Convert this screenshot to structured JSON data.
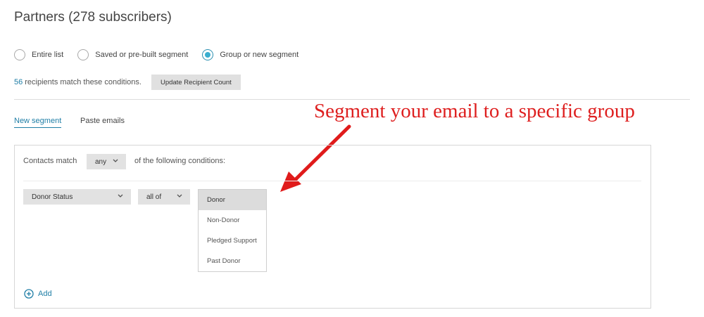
{
  "page_title": "Partners (278 subscribers)",
  "recipient_options": [
    {
      "label": "Entire list",
      "selected": false
    },
    {
      "label": "Saved or pre-built segment",
      "selected": false
    },
    {
      "label": "Group or new segment",
      "selected": true
    }
  ],
  "recipient_count": {
    "number": "56",
    "text": "recipients match these conditions.",
    "update_button": "Update Recipient Count"
  },
  "tabs": [
    {
      "label": "New segment",
      "active": true
    },
    {
      "label": "Paste emails",
      "active": false
    }
  ],
  "annotation": "Segment your email to a specific group",
  "conditions": {
    "prefix": "Contacts match",
    "match_value": "any",
    "suffix": "of the following conditions:",
    "field": "Donor Status",
    "operator": "all of",
    "options": [
      "Donor",
      "Non-Donor",
      "Pledged Support",
      "Past Donor"
    ],
    "highlighted_option": "Donor"
  },
  "add_label": "Add",
  "colors": {
    "accent": "#1f7ea6",
    "radio_selected": "#3aaecf",
    "annotation": "#de1f1f",
    "control_bg": "#e2e2e2"
  },
  "icons": [
    "radio-icon",
    "chevron-down-icon",
    "add-circle-icon",
    "arrow-icon"
  ]
}
